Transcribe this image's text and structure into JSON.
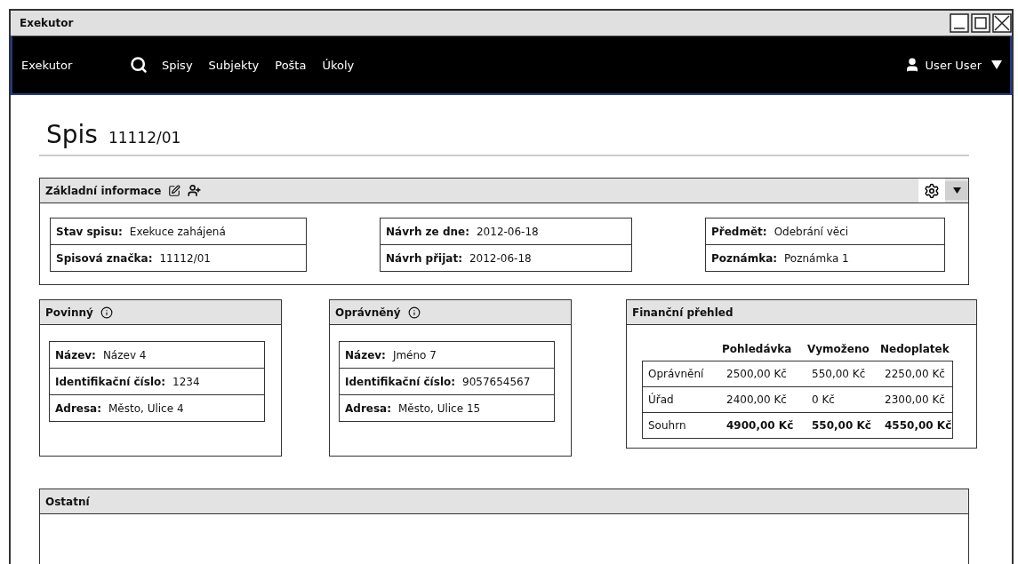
{
  "window": {
    "title": "Exekutor"
  },
  "navbar": {
    "brand": "Exekutor",
    "items": [
      "Spisy",
      "Subjekty",
      "Pošta",
      "Úkoly"
    ],
    "user": "User User"
  },
  "page": {
    "heading": "Spis",
    "case_number": "11112/01"
  },
  "basic_info": {
    "title": "Základní informace",
    "groups": [
      [
        {
          "label": "Stav spisu:",
          "value": "Exekuce zahájená"
        },
        {
          "label": "Spisová značka:",
          "value": "11112/01"
        }
      ],
      [
        {
          "label": "Návrh ze dne:",
          "value": "2012-06-18"
        },
        {
          "label": "Návrh přijat:",
          "value": "2012-06-18"
        }
      ],
      [
        {
          "label": "Předmět:",
          "value": "Odebrání věci"
        },
        {
          "label": "Poznámka:",
          "value": "Poznámka 1"
        }
      ]
    ]
  },
  "parties": [
    {
      "title": "Povinný",
      "fields": [
        {
          "label": "Název:",
          "value": "Název 4"
        },
        {
          "label": "Identifikační číslo:",
          "value": "1234"
        },
        {
          "label": "Adresa:",
          "value": "Město, Ulice 4"
        }
      ]
    },
    {
      "title": "Oprávněný",
      "fields": [
        {
          "label": "Název:",
          "value": "Jméno 7"
        },
        {
          "label": "Identifikační číslo:",
          "value": "9057654567"
        },
        {
          "label": "Adresa:",
          "value": "Město, Ulice 15"
        }
      ]
    }
  ],
  "finance": {
    "title": "Finanční přehled",
    "columns": [
      "Pohledávka",
      "Vymoženo",
      "Nedoplatek"
    ],
    "rows": [
      {
        "kind": "normal",
        "label": "Oprávnění",
        "cells": [
          "2500,00 Kč",
          "550,00 Kč",
          "2250,00 Kč"
        ]
      },
      {
        "kind": "normal",
        "label": "Úřad",
        "cells": [
          "2400,00 Kč",
          "0 Kč",
          "2300,00 Kč"
        ]
      },
      {
        "kind": "total",
        "label": "Souhrn",
        "cells": [
          "4900,00 Kč",
          "550,00 Kč",
          "4550,00 Kč"
        ]
      }
    ]
  },
  "other": {
    "title": "Ostatní"
  }
}
